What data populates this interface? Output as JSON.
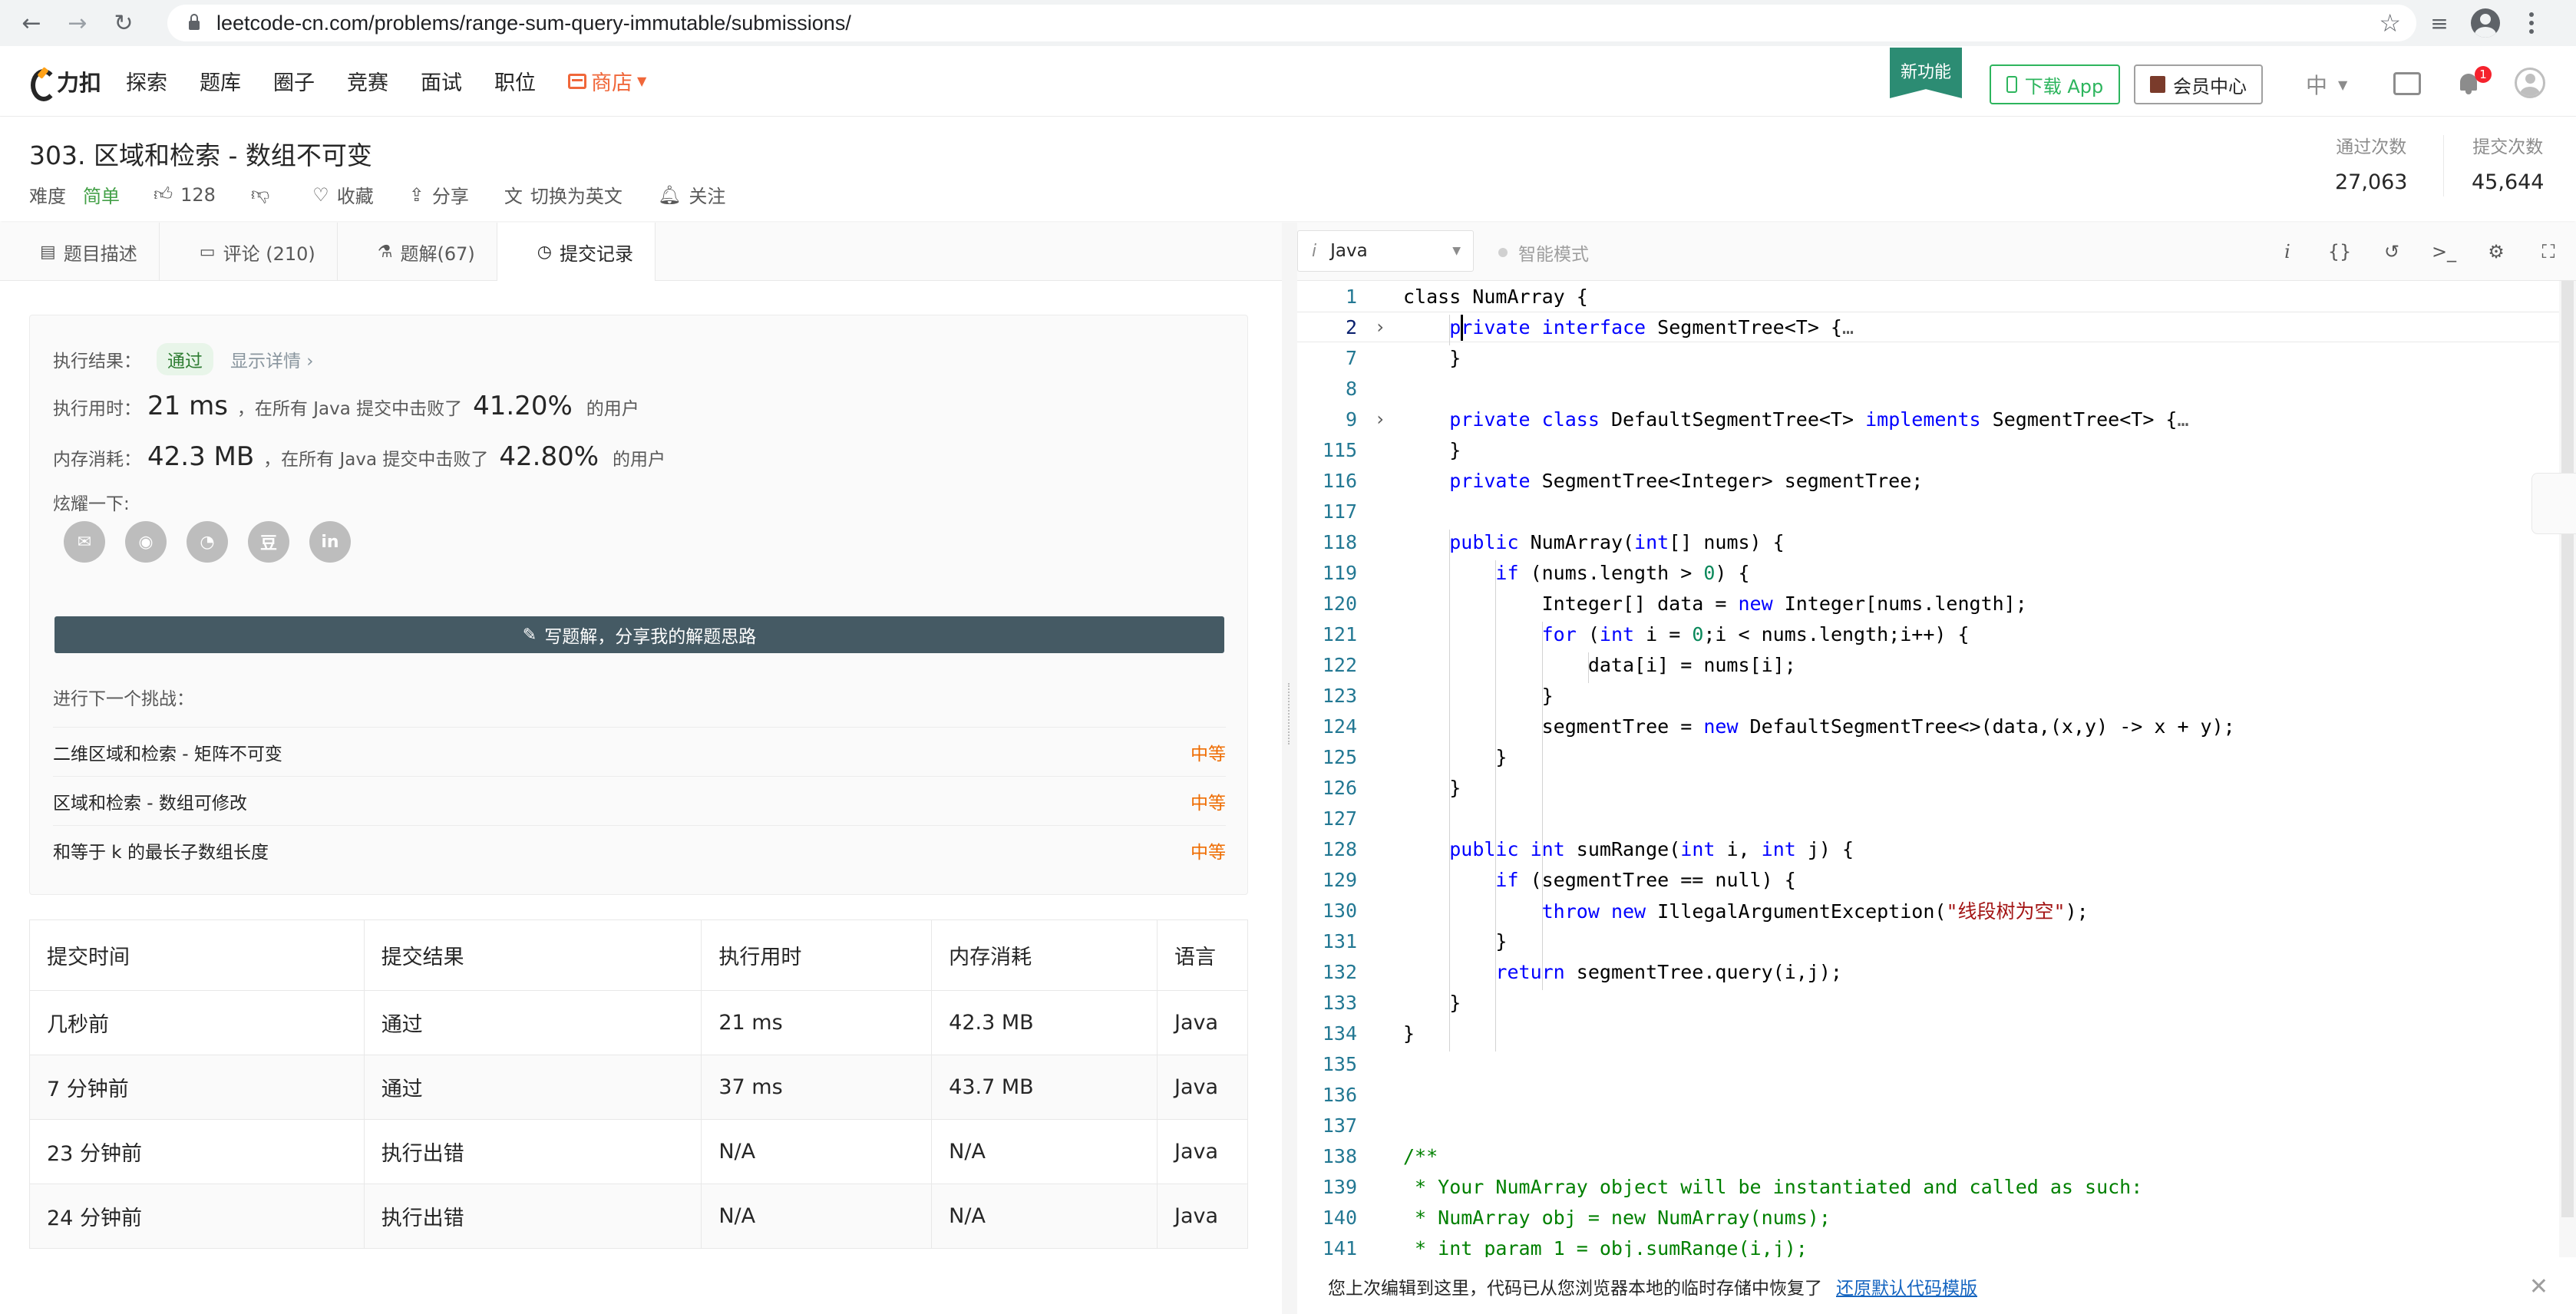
{
  "browser": {
    "url": "leetcode-cn.com/problems/range-sum-query-immutable/submissions/"
  },
  "site": {
    "logo_text": "力扣",
    "nav": [
      "探索",
      "题库",
      "圈子",
      "竞赛",
      "面试",
      "职位"
    ],
    "shop_label": "商店",
    "new_feature_label": "新功能",
    "download_label": "下载 App",
    "vip_label": "会员中心",
    "lang_label": "中",
    "notification_count": "1"
  },
  "problem": {
    "title": "303. 区域和检索 - 数组不可变",
    "difficulty_label": "难度",
    "difficulty": "简单",
    "likes": "128",
    "collect_label": "收藏",
    "share_label": "分享",
    "switch_lang_label": "切换为英文",
    "follow_label": "关注",
    "accepted_label": "通过次数",
    "accepted_value": "27,063",
    "submissions_label": "提交次数",
    "submissions_value": "45,644"
  },
  "tabs": [
    {
      "label": "题目描述"
    },
    {
      "label": "评论 (210)"
    },
    {
      "label": "题解(67)"
    },
    {
      "label": "提交记录"
    }
  ],
  "result": {
    "result_label": "执行结果：",
    "status": "通过",
    "details_label": "显示详情 ›",
    "runtime_label": "执行用时：",
    "runtime_value": "21 ms",
    "runtime_mid": "，在所有 Java 提交中击败了",
    "runtime_pct": "41.20%",
    "users_suffix": "的用户",
    "memory_label": "内存消耗：",
    "memory_value": "42.3 MB",
    "memory_mid": "，在所有 Java 提交中击败了",
    "memory_pct": "42.80%",
    "show_off_label": "炫耀一下:",
    "share_icons": [
      "wechat-icon",
      "weibo-icon",
      "qq-icon",
      "douban-icon",
      "linkedin-icon"
    ],
    "share_glyphs": [
      "✉",
      "◉",
      "◔",
      "豆",
      "in"
    ],
    "write_solution_label": "写题解，分享我的解题思路",
    "next_challenge_label": "进行下一个挑战：",
    "challenges": [
      {
        "title": "二维区域和检索 - 矩阵不可变",
        "level": "中等"
      },
      {
        "title": "区域和检索 - 数组可修改",
        "level": "中等"
      },
      {
        "title": "和等于 k 的最长子数组长度",
        "level": "中等"
      }
    ]
  },
  "submissions": {
    "headers": [
      "提交时间",
      "提交结果",
      "执行用时",
      "内存消耗",
      "语言"
    ],
    "rows": [
      {
        "time": "几秒前",
        "status": "通过",
        "runtime": "21 ms",
        "memory": "42.3 MB",
        "lang": "Java"
      },
      {
        "time": "7 分钟前",
        "status": "通过",
        "runtime": "37 ms",
        "memory": "43.7 MB",
        "lang": "Java"
      },
      {
        "time": "23 分钟前",
        "status": "执行出错",
        "runtime": "N/A",
        "memory": "N/A",
        "lang": "Java"
      },
      {
        "time": "24 分钟前",
        "status": "执行出错",
        "runtime": "N/A",
        "memory": "N/A",
        "lang": "Java"
      }
    ]
  },
  "editor": {
    "language": "Java",
    "smart_mode_label": "智能模式",
    "lines": [
      {
        "n": "1",
        "fold": "",
        "html": "class NumArray {"
      },
      {
        "n": "2",
        "fold": "›",
        "html": "    <span class=\"kw\">private</span> <span class=\"kw\">interface</span> SegmentTree&lt;T&gt; {<span class=\"ellipsis\">…</span>",
        "current": true
      },
      {
        "n": "7",
        "fold": "",
        "html": "    }"
      },
      {
        "n": "8",
        "fold": "",
        "html": ""
      },
      {
        "n": "9",
        "fold": "›",
        "html": "    <span class=\"kw\">private</span> <span class=\"kw\">class</span> DefaultSegmentTree&lt;T&gt; <span class=\"kw\">implements</span> SegmentTree&lt;T&gt; {<span class=\"ellipsis\">…</span>"
      },
      {
        "n": "115",
        "fold": "",
        "html": "    }"
      },
      {
        "n": "116",
        "fold": "",
        "html": "    <span class=\"kw\">private</span> SegmentTree&lt;Integer&gt; segmentTree;"
      },
      {
        "n": "117",
        "fold": "",
        "html": ""
      },
      {
        "n": "118",
        "fold": "",
        "html": "    <span class=\"kw\">public</span> NumArray(<span class=\"kw\">int</span>[] nums) {"
      },
      {
        "n": "119",
        "fold": "",
        "html": "        <span class=\"kw\">if</span> (nums.length &gt; <span class=\"num\">0</span>) {"
      },
      {
        "n": "120",
        "fold": "",
        "html": "            Integer[] data = <span class=\"kw\">new</span> Integer[nums.length];"
      },
      {
        "n": "121",
        "fold": "",
        "html": "            <span class=\"kw\">for</span> (<span class=\"kw\">int</span> i = <span class=\"num\">0</span>;i &lt; nums.length;i++) {"
      },
      {
        "n": "122",
        "fold": "",
        "html": "                data[i] = nums[i];"
      },
      {
        "n": "123",
        "fold": "",
        "html": "            }"
      },
      {
        "n": "124",
        "fold": "",
        "html": "            segmentTree = <span class=\"kw\">new</span> DefaultSegmentTree&lt;&gt;(data,(x,y) -&gt; x + y);"
      },
      {
        "n": "125",
        "fold": "",
        "html": "        }"
      },
      {
        "n": "126",
        "fold": "",
        "html": "    }"
      },
      {
        "n": "127",
        "fold": "",
        "html": ""
      },
      {
        "n": "128",
        "fold": "",
        "html": "    <span class=\"kw\">public</span> <span class=\"kw\">int</span> sumRange(<span class=\"kw\">int</span> i, <span class=\"kw\">int</span> j) {"
      },
      {
        "n": "129",
        "fold": "",
        "html": "        <span class=\"kw\">if</span> (segmentTree == null) {"
      },
      {
        "n": "130",
        "fold": "",
        "html": "            <span class=\"kw\">throw</span> <span class=\"kw\">new</span> IllegalArgumentException(<span class=\"str\">\"线段树为空\"</span>);"
      },
      {
        "n": "131",
        "fold": "",
        "html": "        }"
      },
      {
        "n": "132",
        "fold": "",
        "html": "        <span class=\"kw\">return</span> segmentTree.query(i,j);"
      },
      {
        "n": "133",
        "fold": "",
        "html": "    }"
      },
      {
        "n": "134",
        "fold": "",
        "html": "}"
      },
      {
        "n": "135",
        "fold": "",
        "html": ""
      },
      {
        "n": "136",
        "fold": "",
        "html": ""
      },
      {
        "n": "137",
        "fold": "",
        "html": ""
      },
      {
        "n": "138",
        "fold": "",
        "html": "<span class=\"cmt\">/**</span>"
      },
      {
        "n": "139",
        "fold": "",
        "html": "<span class=\"cmt\"> * Your NumArray object will be instantiated and called as such:</span>"
      },
      {
        "n": "140",
        "fold": "",
        "html": "<span class=\"cmt\"> * NumArray obj = new NumArray(nums);</span>"
      },
      {
        "n": "141",
        "fold": "",
        "html": "<span class=\"cmt\"> * int param_1 = obj.sumRange(i,j);</span>"
      }
    ]
  },
  "restore": {
    "message": "您上次编辑到这里，代码已从您浏览器本地的临时存储中恢复了",
    "link": "还原默认代码模版",
    "close": "✕"
  }
}
